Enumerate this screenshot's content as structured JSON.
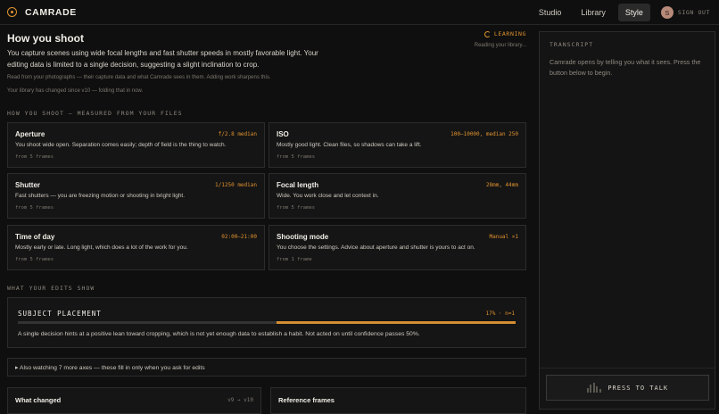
{
  "app": {
    "name": "CAMRADE"
  },
  "nav": {
    "tabs": [
      "Studio",
      "Library",
      "Style"
    ],
    "active": "Style",
    "avatar_initial": "S",
    "signout": "SIGN OUT"
  },
  "header": {
    "title": "How you shoot",
    "status": "LEARNING",
    "status_sub": "Reading your library...",
    "summary": "You capture scenes using wide focal lengths and fast shutter speeds in mostly favorable light. Your editing data is limited to a single decision, suggesting a slight inclination to crop.",
    "note_source": "Read from your photographs — their capture data and what Camrade sees in them. Adding work sharpens this.",
    "note_changed": "Your library has changed since v10 — folding that in now."
  },
  "shoot_section": {
    "title": "HOW YOU SHOOT — MEASURED FROM YOUR FILES",
    "cards": [
      {
        "name": "Aperture",
        "value": "f/2.8 median",
        "desc": "You shoot wide open. Separation comes easily; depth of field is the thing to watch.",
        "frames": "from 5 frames"
      },
      {
        "name": "ISO",
        "value": "100–10000, median 250",
        "desc": "Mostly good light. Clean files, so shadows can take a lift.",
        "frames": "from 5 frames"
      },
      {
        "name": "Shutter",
        "value": "1/1250 median",
        "desc": "Fast shutters — you are freezing motion or shooting in bright light.",
        "frames": "from 5 frames"
      },
      {
        "name": "Focal length",
        "value": "28mm, 44mm",
        "desc": "Wide. You work close and let context in.",
        "frames": "from 5 frames"
      },
      {
        "name": "Time of day",
        "value": "02:00–21:00",
        "desc": "Mostly early or late. Long light, which does a lot of the work for you.",
        "frames": "from 5 frames"
      },
      {
        "name": "Shooting mode",
        "value": "Manual ×1",
        "desc": "You choose the settings. Advice about aperture and shutter is yours to act on.",
        "frames": "from 1 frame"
      }
    ]
  },
  "edits_section": {
    "title": "WHAT YOUR EDITS SHOW",
    "edit": {
      "name": "SUBJECT PLACEMENT",
      "value": "17% · n=1",
      "lean_fraction": 0.5,
      "desc": "A single decision hints at a positive lean toward cropping, which is not yet enough data to establish a habit. Not acted on until confidence passes 50%."
    },
    "also": "▸ Also watching 7 more axes — these fill in only when you ask for edits"
  },
  "bottom": {
    "changed_title": "What changed",
    "changed_meta": "v9 → v10",
    "reference_title": "Reference frames"
  },
  "transcript": {
    "title": "TRANSCRIPT",
    "text": "Camrade opens by telling you what it sees. Press the button below to begin.",
    "button": "PRESS TO TALK"
  },
  "colors": {
    "accent": "#e0922f",
    "background": "#0f0f0f",
    "card": "#151515",
    "border": "#2c2c2c"
  }
}
